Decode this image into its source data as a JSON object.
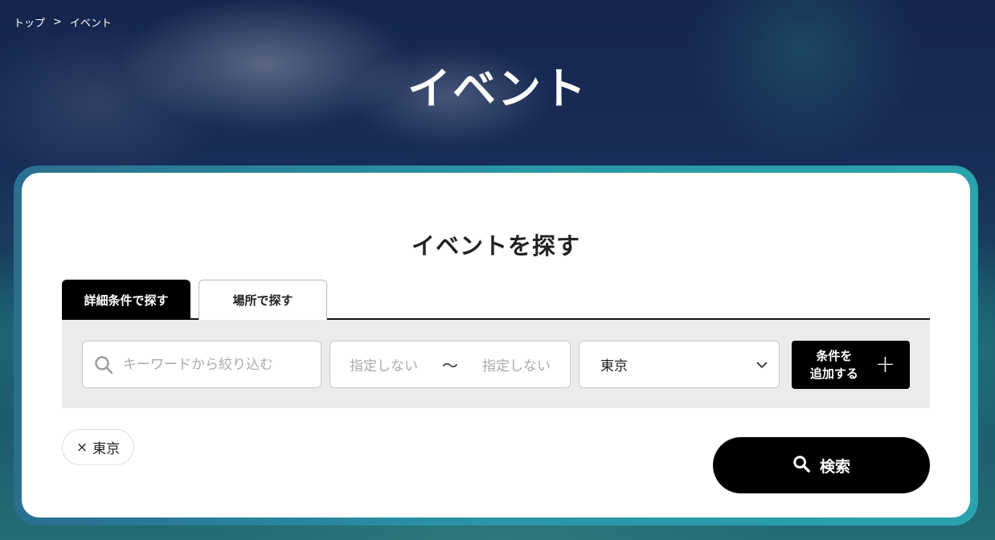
{
  "breadcrumb": {
    "home": "トップ",
    "separator": ">",
    "current": "イベント"
  },
  "page_title": "イベント",
  "search": {
    "title": "イベントを探す",
    "tabs": [
      {
        "label": "詳細条件で探す",
        "active": true
      },
      {
        "label": "場所で探す",
        "active": false
      }
    ],
    "keyword_placeholder": "キーワードから絞り込む",
    "date_from": "指定しない",
    "date_tilde": "〜",
    "date_to": "指定しない",
    "region_selected": "東京",
    "add_condition_line1": "条件を",
    "add_condition_line2": "追加する",
    "add_condition_plus": "+",
    "active_filter": {
      "close": "×",
      "label": "東京"
    },
    "search_button": "検索"
  },
  "colors": {
    "accent": "#000000",
    "frame": "#2a95a6",
    "filter_bg": "#ebebeb"
  }
}
